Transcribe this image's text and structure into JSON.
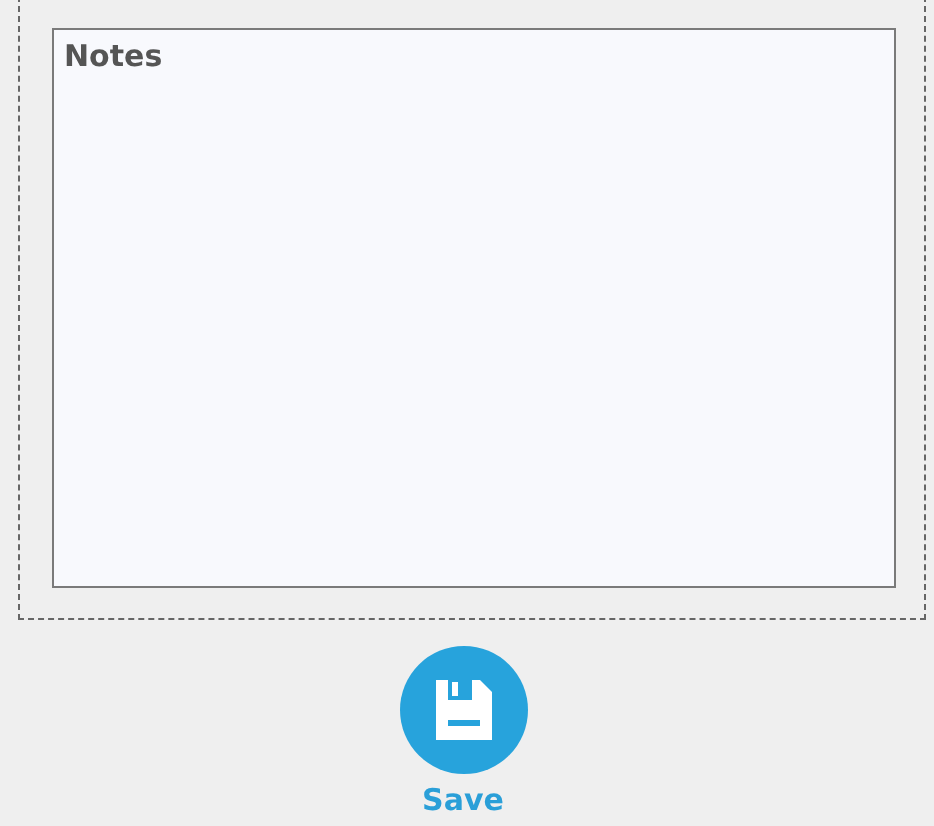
{
  "notes": {
    "label": "Notes"
  },
  "save_button": {
    "label": "Save"
  }
}
